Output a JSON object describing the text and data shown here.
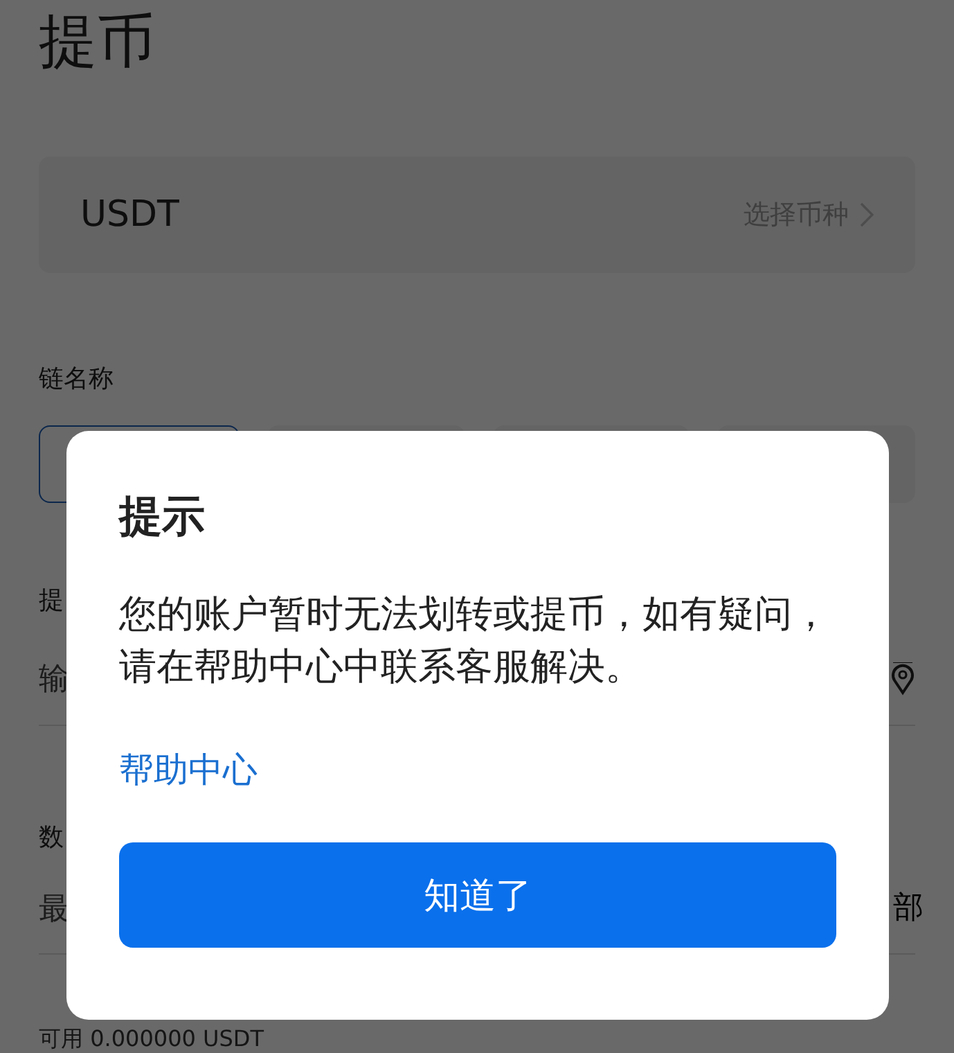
{
  "page": {
    "title": "提币",
    "coin": {
      "name": "USDT",
      "action": "选择币种"
    },
    "chain_label": "链名称",
    "chains": [
      {
        "selected": true
      },
      {
        "selected": false
      },
      {
        "selected": false
      },
      {
        "selected": false
      }
    ],
    "address_label": "提",
    "address_placeholder": "输",
    "amount_label": "数",
    "amount_placeholder": "最",
    "amount_all": "部",
    "available": "可用 0.000000 USDT"
  },
  "dialog": {
    "title": "提示",
    "message": "您的账户暂时无法划转或提币，如有疑问，请在帮助中心中联系客服解决。",
    "link": "帮助中心",
    "button": "知道了"
  }
}
